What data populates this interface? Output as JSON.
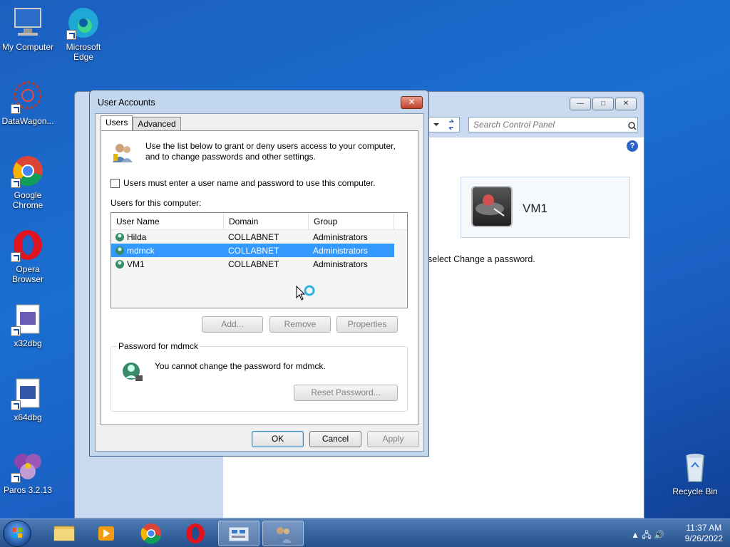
{
  "desktop": {
    "icons": [
      {
        "label": "My Computer",
        "icon": "computer-icon"
      },
      {
        "label": "Microsoft Edge",
        "icon": "edge-icon"
      },
      {
        "label": "DataWagon...",
        "icon": "datawagon-icon"
      },
      {
        "label": "Google Chrome",
        "icon": "chrome-icon"
      },
      {
        "label": "Opera Browser",
        "icon": "opera-icon"
      },
      {
        "label": "x32dbg",
        "icon": "x32dbg-icon"
      },
      {
        "label": "x64dbg",
        "icon": "x64dbg-icon"
      },
      {
        "label": "Paros 3.2.13",
        "icon": "paros-icon"
      },
      {
        "label": "Recycle Bin",
        "icon": "recycle-bin-icon"
      }
    ]
  },
  "control_panel": {
    "search_placeholder": "Search Control Panel",
    "account_name": "VM1",
    "partial_text": "select Change a password.",
    "buttons": {
      "minimize": "—",
      "maximize": "□",
      "close": "✕"
    }
  },
  "dialog": {
    "title": "User Accounts",
    "close_label": "✕",
    "tabs": [
      "Users",
      "Advanced"
    ],
    "intro": "Use the list below to grant or deny users access to your computer, and to change passwords and other settings.",
    "checkbox_label": "Users must enter a user name and password to use this computer.",
    "checkbox_checked": false,
    "users_label": "Users for this computer:",
    "columns": [
      "User Name",
      "Domain",
      "Group"
    ],
    "users": [
      {
        "name": "Hilda",
        "domain": "COLLABNET",
        "group": "Administrators"
      },
      {
        "name": "mdmck",
        "domain": "COLLABNET",
        "group": "Administrators"
      },
      {
        "name": "VM1",
        "domain": "COLLABNET",
        "group": "Administrators"
      }
    ],
    "selected_user": "mdmck",
    "buttons": {
      "add": "Add...",
      "remove": "Remove",
      "properties": "Properties",
      "reset_password": "Reset Password...",
      "ok": "OK",
      "cancel": "Cancel",
      "apply": "Apply"
    },
    "password_group_title": "Password for mdmck",
    "password_message": "You cannot change the password for mdmck."
  },
  "taskbar": {
    "items": [
      "explorer-icon",
      "media-player-icon",
      "chrome-icon",
      "opera-icon",
      "control-panel-icon",
      "user-accounts-icon"
    ],
    "time": "11:37 AM",
    "date": "9/26/2022"
  }
}
